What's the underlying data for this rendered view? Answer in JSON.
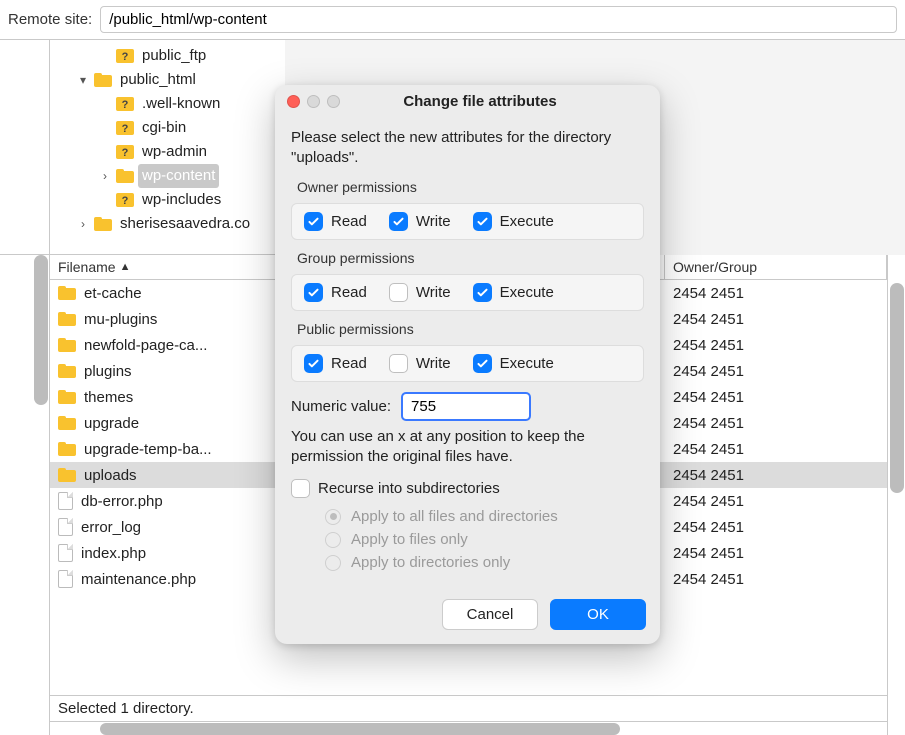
{
  "topbar": {
    "label": "Remote site:",
    "path": "/public_html/wp-content"
  },
  "tree": [
    {
      "depth": 2,
      "expander": "",
      "icon": "q",
      "name": "public_ftp"
    },
    {
      "depth": 1,
      "expander": "v",
      "icon": "folder",
      "name": "public_html"
    },
    {
      "depth": 2,
      "expander": "",
      "icon": "q",
      "name": ".well-known"
    },
    {
      "depth": 2,
      "expander": "",
      "icon": "q",
      "name": "cgi-bin"
    },
    {
      "depth": 2,
      "expander": "",
      "icon": "q",
      "name": "wp-admin"
    },
    {
      "depth": 2,
      "expander": ">",
      "icon": "folder",
      "name": "wp-content",
      "selected": true
    },
    {
      "depth": 2,
      "expander": "",
      "icon": "q",
      "name": "wp-includes"
    },
    {
      "depth": 1,
      "expander": ">",
      "icon": "folder",
      "name": "sherisesaavedra.co"
    }
  ],
  "columns": {
    "filename": "Filename",
    "owner": "Owner/Group"
  },
  "rows": [
    {
      "icon": "folder",
      "name": "et-cache",
      "owner": "2454 2451"
    },
    {
      "icon": "folder",
      "name": "mu-plugins",
      "owner": "2454 2451"
    },
    {
      "icon": "folder",
      "name": "newfold-page-ca...",
      "owner": "2454 2451"
    },
    {
      "icon": "folder",
      "name": "plugins",
      "owner": "2454 2451"
    },
    {
      "icon": "folder",
      "name": "themes",
      "owner": "2454 2451"
    },
    {
      "icon": "folder",
      "name": "upgrade",
      "owner": "2454 2451"
    },
    {
      "icon": "folder",
      "name": "upgrade-temp-ba...",
      "owner": "2454 2451"
    },
    {
      "icon": "folder",
      "name": "uploads",
      "owner": "2454 2451",
      "selected": true
    },
    {
      "icon": "file",
      "name": "db-error.php",
      "owner": "2454 2451"
    },
    {
      "icon": "file",
      "name": "error_log",
      "owner": "2454 2451"
    },
    {
      "icon": "file",
      "name": "index.php",
      "owner": "2454 2451"
    },
    {
      "icon": "file",
      "name": "maintenance.php",
      "owner": "2454 2451"
    }
  ],
  "status": "Selected 1 directory.",
  "dialog": {
    "title": "Change file attributes",
    "instructions": "Please select the new attributes for the directory \"uploads\".",
    "groups": [
      {
        "title": "Owner permissions",
        "read": true,
        "write": true,
        "execute": true
      },
      {
        "title": "Group permissions",
        "read": true,
        "write": false,
        "execute": true
      },
      {
        "title": "Public permissions",
        "read": true,
        "write": false,
        "execute": true
      }
    ],
    "perm_labels": {
      "read": "Read",
      "write": "Write",
      "execute": "Execute"
    },
    "numeric_label": "Numeric value:",
    "numeric_value": "755",
    "note": "You can use an x at any position to keep the permission the original files have.",
    "recurse_label": "Recurse into subdirectories",
    "recurse_checked": false,
    "radios": [
      {
        "label": "Apply to all files and directories",
        "selected": true
      },
      {
        "label": "Apply to files only",
        "selected": false
      },
      {
        "label": "Apply to directories only",
        "selected": false
      }
    ],
    "cancel": "Cancel",
    "ok": "OK"
  }
}
